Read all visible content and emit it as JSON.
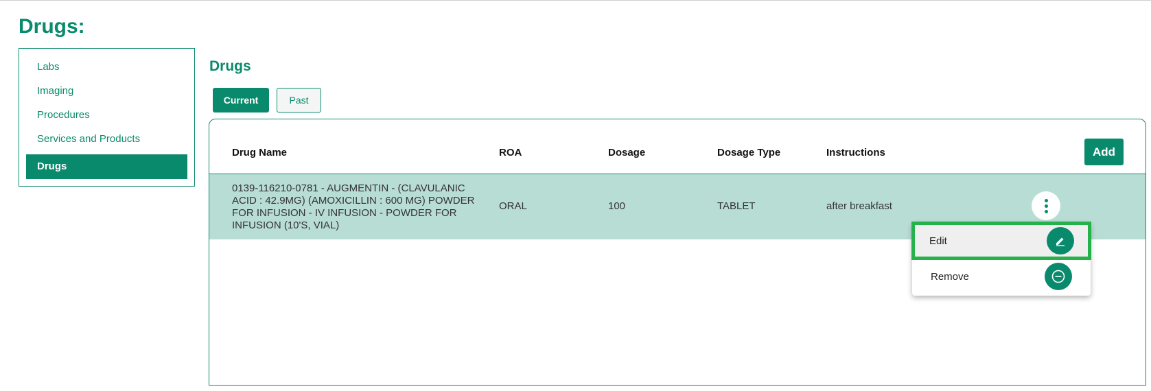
{
  "page": {
    "title": "Drugs:"
  },
  "sidebar": {
    "items": [
      {
        "label": "Labs"
      },
      {
        "label": "Imaging"
      },
      {
        "label": "Procedures"
      },
      {
        "label": "Services and Products"
      },
      {
        "label": "Drugs",
        "active": true
      }
    ]
  },
  "section": {
    "title": "Drugs"
  },
  "tabs": {
    "current": "Current",
    "past": "Past"
  },
  "table": {
    "headers": {
      "name": "Drug Name",
      "roa": "ROA",
      "dosage": "Dosage",
      "dosage_type": "Dosage Type",
      "instructions": "Instructions"
    },
    "add_label": "Add",
    "rows": [
      {
        "name": "0139-116210-0781 - AUGMENTIN - (CLAVULANIC ACID : 42.9MG) (AMOXICILLIN : 600 MG) POWDER FOR INFUSION - IV INFUSION - POWDER FOR INFUSION (10'S, VIAL)",
        "roa": "ORAL",
        "dosage": "100",
        "dosage_type": "TABLET",
        "instructions": "after breakfast"
      }
    ]
  },
  "menu": {
    "edit": "Edit",
    "remove": "Remove"
  },
  "colors": {
    "brand": "#0a8a6c",
    "row_highlight": "#b8ddd5",
    "focus": "#26b24a"
  },
  "icons": {
    "row_actions": "kebab-icon",
    "edit": "pencil-icon",
    "remove": "minus-circle-icon"
  }
}
